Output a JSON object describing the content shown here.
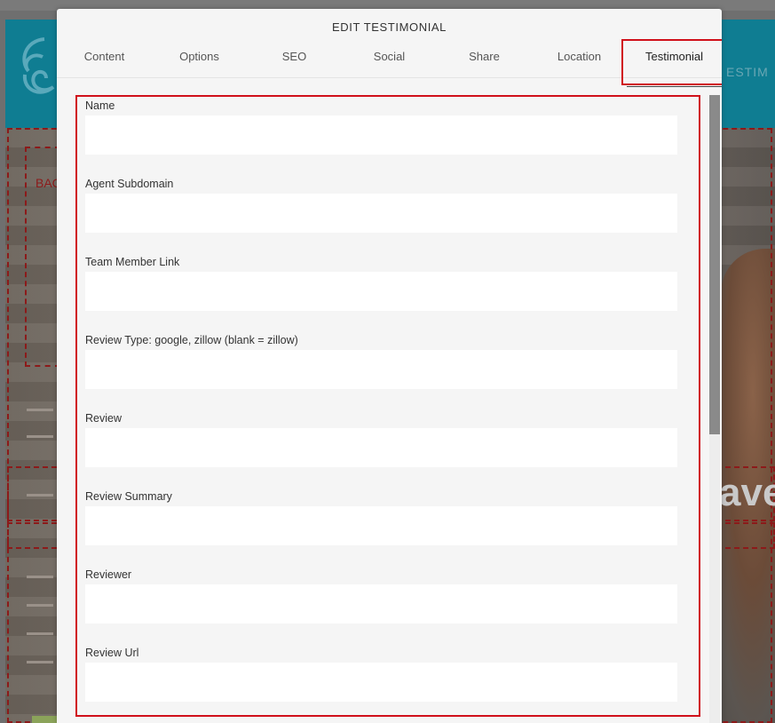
{
  "modal": {
    "title": "EDIT TESTIMONIAL",
    "tabs": [
      {
        "label": "Content"
      },
      {
        "label": "Options"
      },
      {
        "label": "SEO"
      },
      {
        "label": "Social"
      },
      {
        "label": "Share"
      },
      {
        "label": "Location"
      },
      {
        "label": "Testimonial"
      }
    ],
    "active_tab": "Testimonial",
    "fields": [
      {
        "label": "Name",
        "value": ""
      },
      {
        "label": "Agent Subdomain",
        "value": ""
      },
      {
        "label": "Team Member Link",
        "value": ""
      },
      {
        "label": "Review Type: google, zillow (blank = zillow)",
        "value": ""
      },
      {
        "label": "Review",
        "value": ""
      },
      {
        "label": "Review Summary",
        "value": ""
      },
      {
        "label": "Reviewer",
        "value": ""
      },
      {
        "label": "Review Url",
        "value": ""
      }
    ]
  },
  "background": {
    "nav_fragment": "ESTIM",
    "bac_fragment": "BAC",
    "ave_fragment": "ave"
  },
  "colors": {
    "highlight": "#d0101a",
    "header_bg": "#0f7d92"
  }
}
